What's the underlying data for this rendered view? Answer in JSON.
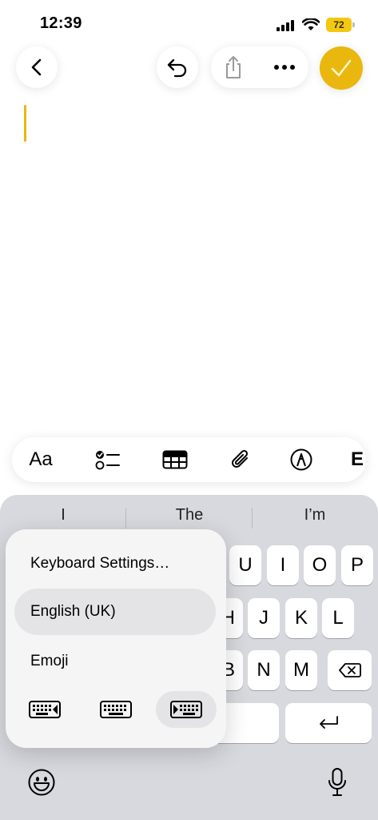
{
  "status_bar": {
    "time": "12:39",
    "battery_level": "72",
    "battery_color": "#f2c811"
  },
  "nav": {
    "back_icon": "chevron-left-icon",
    "undo_icon": "undo-icon",
    "share_icon": "share-icon",
    "more_icon": "ellipsis-icon",
    "done_icon": "checkmark-icon",
    "accent_color": "#e9b70e"
  },
  "format_toolbar": {
    "text_style_label": "Aa",
    "checklist_icon": "checklist-icon",
    "table_icon": "table-icon",
    "attach_icon": "paperclip-icon",
    "markup_icon": "markup-pen-icon",
    "cut_off_label": "E"
  },
  "keyboard": {
    "suggestions": [
      "I",
      "The",
      "I’m"
    ],
    "row1_visible": [
      "U",
      "I",
      "O",
      "P"
    ],
    "row2_visible": [
      "H",
      "J",
      "K",
      "L"
    ],
    "row3_visible": [
      "B",
      "N",
      "M"
    ],
    "delete_icon": "delete-backward-icon",
    "return_icon": "return-icon",
    "emoji_icon": "emoji-face-icon",
    "mic_icon": "microphone-icon"
  },
  "popup_menu": {
    "items": [
      {
        "label": "Keyboard Settings…"
      },
      {
        "label": "English (UK)",
        "selected": true
      },
      {
        "label": "Emoji"
      }
    ],
    "keyboard_modes": [
      {
        "icon": "keyboard-left-icon"
      },
      {
        "icon": "keyboard-full-icon"
      },
      {
        "icon": "keyboard-right-icon",
        "selected": true
      }
    ]
  }
}
